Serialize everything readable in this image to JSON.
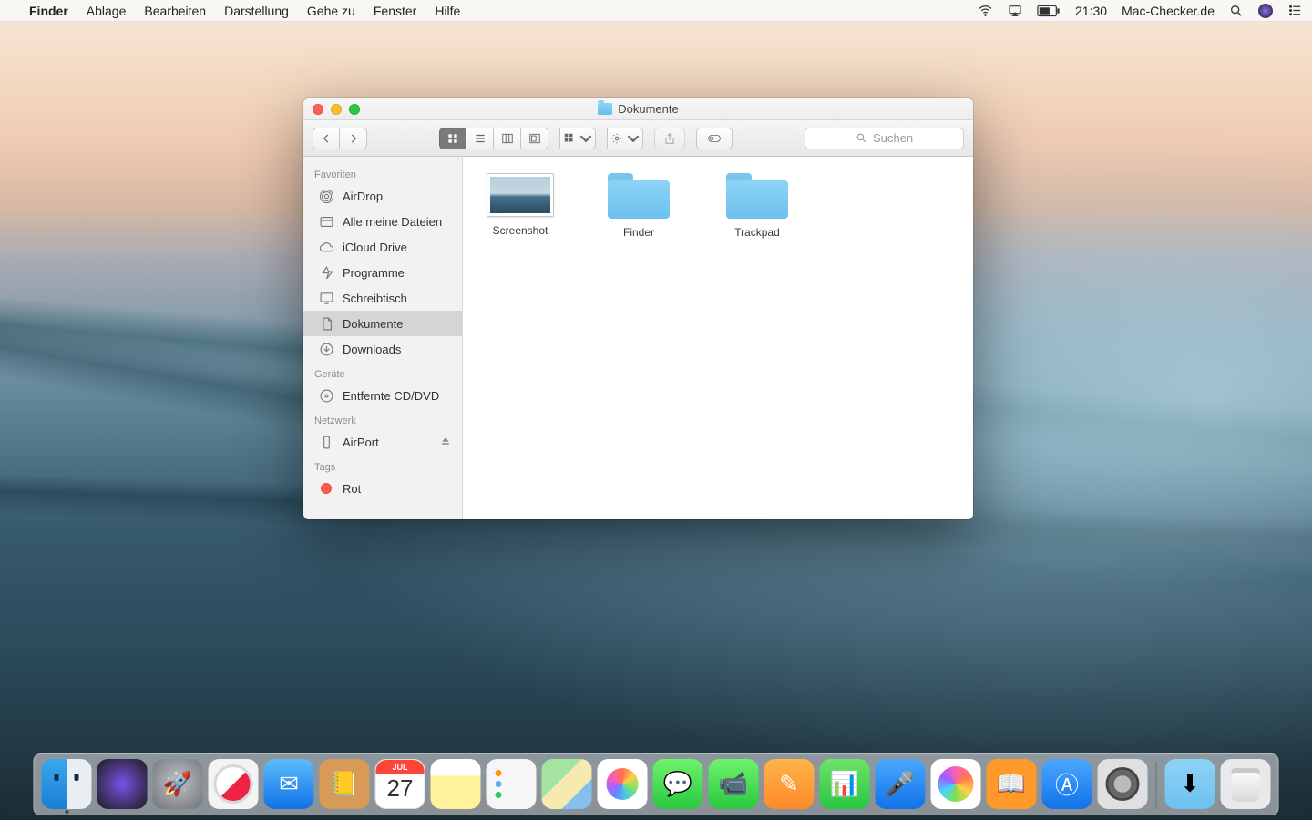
{
  "menubar": {
    "app": "Finder",
    "items": [
      "Ablage",
      "Bearbeiten",
      "Darstellung",
      "Gehe zu",
      "Fenster",
      "Hilfe"
    ],
    "time": "21:30",
    "site": "Mac-Checker.de"
  },
  "window": {
    "title": "Dokumente",
    "search_placeholder": "Suchen"
  },
  "sidebar": {
    "favorites": {
      "h": "Favoriten",
      "items": [
        "AirDrop",
        "Alle meine Dateien",
        "iCloud Drive",
        "Programme",
        "Schreibtisch",
        "Dokumente",
        "Downloads"
      ]
    },
    "devices": {
      "h": "Geräte",
      "items": [
        "Entfernte CD/DVD"
      ]
    },
    "network": {
      "h": "Netzwerk",
      "items": [
        "AirPort"
      ]
    },
    "tags": {
      "h": "Tags",
      "items": [
        "Rot"
      ]
    }
  },
  "files": {
    "0": {
      "name": "Screenshot"
    },
    "1": {
      "name": "Finder"
    },
    "2": {
      "name": "Trackpad"
    }
  },
  "calendar": {
    "month": "JUL",
    "day": "27"
  }
}
